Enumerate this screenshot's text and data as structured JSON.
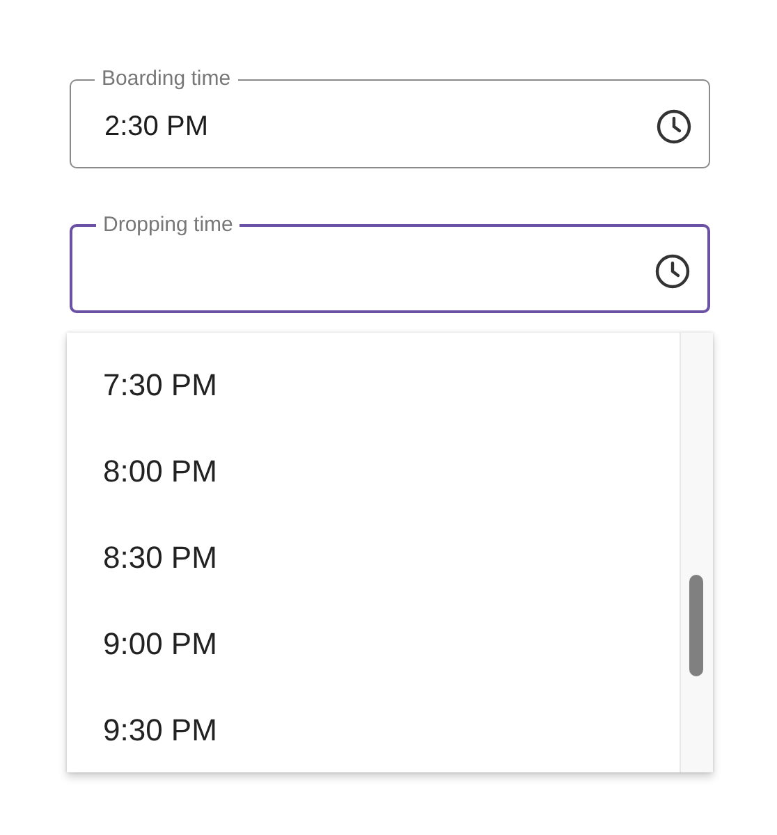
{
  "fields": [
    {
      "label": "Boarding time",
      "value": "2:30 PM",
      "focused": false
    },
    {
      "label": "Dropping time",
      "focused": true
    }
  ],
  "dropdown": {
    "options": [
      "7:30 PM",
      "8:00 PM",
      "8:30 PM",
      "9:00 PM",
      "9:30 PM"
    ]
  }
}
